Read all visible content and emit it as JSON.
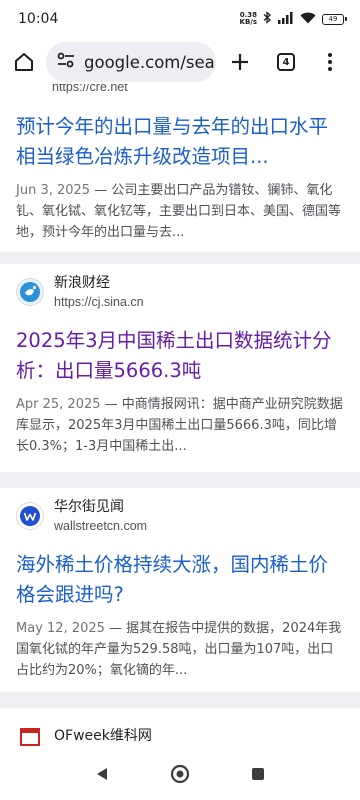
{
  "status": {
    "time": "10:04",
    "net_speed_value": "0.38",
    "net_speed_unit": "KB/s",
    "battery": "49"
  },
  "toolbar": {
    "url": "google.com/search",
    "tab_count": "4"
  },
  "results": [
    {
      "url": "https://cre.net",
      "title": "预计今年的出口量与去年的出口水平相当绿色冶炼升级改造项目...",
      "date": "Jun 3, 2025",
      "snippet": " — 公司主要出口产品为镨钕、镧铈、氧化钆、氧化铽、氧化钇等，主要出口到日本、美国、德国等地，预计今年的出口量与去..."
    },
    {
      "site": "新浪财经",
      "url": "https://cj.sina.cn",
      "favicon_text": "sina",
      "title": "2025年3月中国稀土出口数据统计分析：出口量5666.3吨",
      "date": "Apr 25, 2025",
      "snippet": " — 中商情报网讯：据中商产业研究院数据库显示，2025年3月中国稀土出口量5666.3吨，同比增长0.3%；1-3月中国稀土出..."
    },
    {
      "site": "华尔街见闻",
      "url": "wallstreetcn.com",
      "title": "海外稀土价格持续大涨，国内稀土价格会跟进吗?",
      "date": "May 12, 2025",
      "snippet": " — 据其在报告中提供的数据，2024年我国氧化铽的年产量为529.58吨，出口量为107吨，出口占比约为20%；氧化镝的年..."
    },
    {
      "site": "OFweek维科网"
    }
  ],
  "colors": {
    "link": "#1a5fd0",
    "visited": "#681da8",
    "card_gap": "#eef0f3"
  }
}
